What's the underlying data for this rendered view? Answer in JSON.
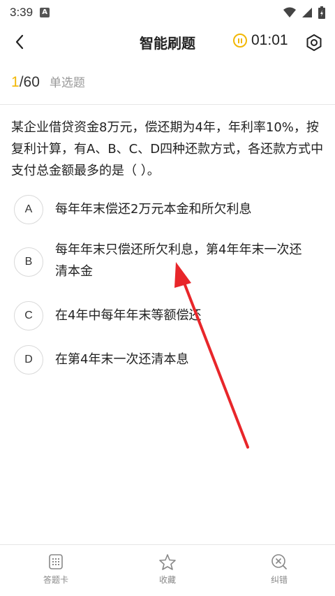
{
  "status_bar": {
    "time": "3:39",
    "notification_badge": "A",
    "icons": [
      "wifi-icon",
      "signal-icon",
      "battery-icon"
    ]
  },
  "header": {
    "title": "智能刷题",
    "timer": "01:01"
  },
  "progress": {
    "current": "1",
    "total": "/60",
    "question_type": "单选题"
  },
  "question": {
    "text": "某企业借贷资金8万元，偿还期为4年，年利率10%，按复利计算，有A、B、C、D四种还款方式，各还款方式中支付总金额最多的是（ ）。"
  },
  "options": [
    {
      "letter": "A",
      "text": "每年年末偿还2万元本金和所欠利息"
    },
    {
      "letter": "B",
      "text": "每年年末只偿还所欠利息，第4年年末一次还清本金"
    },
    {
      "letter": "C",
      "text": "在4年中每年年末等额偿还"
    },
    {
      "letter": "D",
      "text": "在第4年末一次还清本息"
    }
  ],
  "bottom_nav": [
    {
      "label": "答题卡",
      "icon": "answer-card-icon"
    },
    {
      "label": "收藏",
      "icon": "star-icon"
    },
    {
      "label": "纠错",
      "icon": "correction-icon"
    }
  ],
  "colors": {
    "accent": "#f2b705",
    "annotation_arrow": "#e8262a",
    "muted_text": "#999999"
  }
}
